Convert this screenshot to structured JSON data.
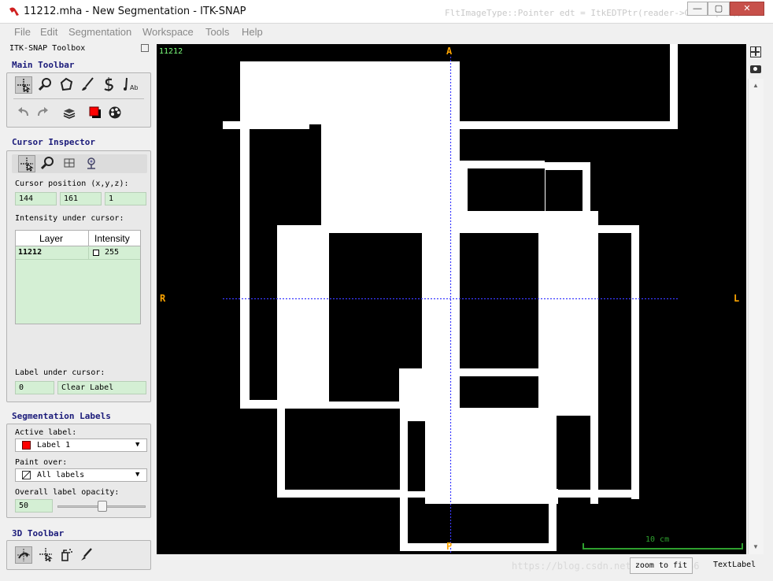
{
  "window": {
    "title": "11212.mha - New Segmentation - ITK-SNAP",
    "background_text": "FltImageType::Pointer edt = ItkEDTPtr(reader->GetOutput()...",
    "controls": {
      "minimize": "—",
      "maximize": "▢",
      "close": "✕"
    }
  },
  "menu": [
    "File",
    "Edit",
    "Segmentation",
    "Workspace",
    "Tools",
    "Help"
  ],
  "toolbox": {
    "title": "ITK-SNAP Toolbox",
    "main_toolbar": {
      "heading": "Main Toolbar",
      "tools": [
        "crosshair-tool",
        "zoom-tool",
        "polygon-tool",
        "paintbrush-tool",
        "snake-tool",
        "annotation-tool"
      ],
      "row2": [
        "undo",
        "redo",
        "layers",
        "label-color",
        "palette"
      ]
    },
    "cursor_inspector": {
      "heading": "Cursor Inspector",
      "tools": [
        "crosshair",
        "zoom",
        "table",
        "anchor"
      ],
      "cursor_position_label": "Cursor position (x,y,z):",
      "x": "144",
      "y": "161",
      "z": "1",
      "intensity_label": "Intensity under cursor:",
      "table_headers": [
        "Layer",
        "Intensity"
      ],
      "table_rows": [
        {
          "layer": "11212",
          "intensity": "255"
        }
      ],
      "label_under_cursor_label": "Label under cursor:",
      "label_id": "0",
      "label_name": "Clear Label"
    },
    "segmentation_labels": {
      "heading": "Segmentation Labels",
      "active_label_title": "Active label:",
      "active_label": "Label 1",
      "active_label_color": "#ff0000",
      "paint_over_title": "Paint over:",
      "paint_over": "All labels",
      "opacity_title": "Overall label opacity:",
      "opacity_value": "50",
      "opacity_fraction": 0.5
    },
    "toolbar_3d": {
      "heading": "3D Toolbar",
      "tools": [
        "rotate-3d",
        "crosshair-3d",
        "spray-3d",
        "scalpel-3d"
      ]
    }
  },
  "viewer": {
    "layer_name": "11212",
    "orientation": {
      "top": "A",
      "bottom": "P",
      "left": "R",
      "right": "L"
    },
    "scale_label": "10 cm",
    "crosshair_color": "#3a3aff",
    "orient_color": "#ffa500"
  },
  "status": {
    "zoom_button": "zoom to fit",
    "text_label": "TextLabel",
    "watermark": "https://blog.csdn.net/qq_41010466"
  }
}
